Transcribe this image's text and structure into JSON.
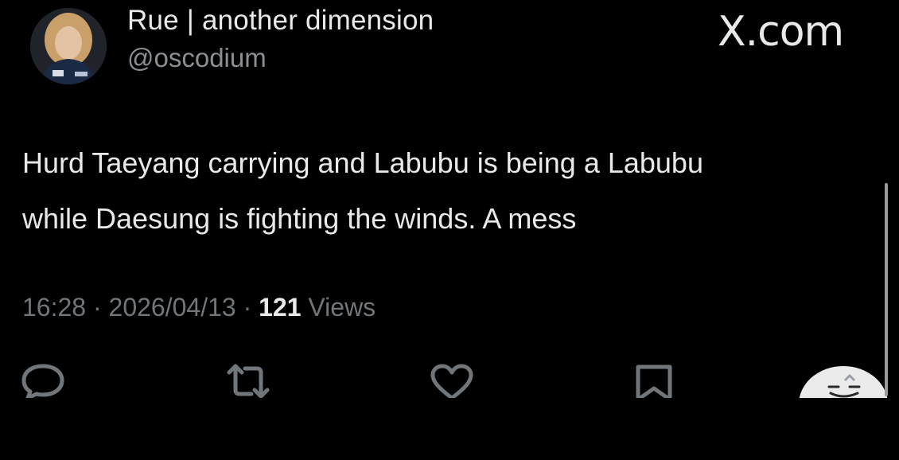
{
  "author": {
    "display_name": "Rue | another dimension",
    "handle": "@oscodium"
  },
  "brand": {
    "label": "X.com"
  },
  "tweet": {
    "lines": [
      "Hurd Taeyang carrying and Labubu is being a Labubu",
      "while Daesung is fighting the winds. A mess"
    ]
  },
  "meta": {
    "time": "16:28",
    "separator": "·",
    "date": "2026/04/13",
    "views_count": "121",
    "views_label": "Views"
  },
  "actions": [
    {
      "icon": "reply-icon"
    },
    {
      "icon": "retweet-icon"
    },
    {
      "icon": "heart-icon"
    },
    {
      "icon": "bookmark-icon"
    }
  ],
  "colors": {
    "background": "#000000",
    "primary_text": "#e7e9ea",
    "secondary_text": "#71767b",
    "icon": "#71767b"
  }
}
